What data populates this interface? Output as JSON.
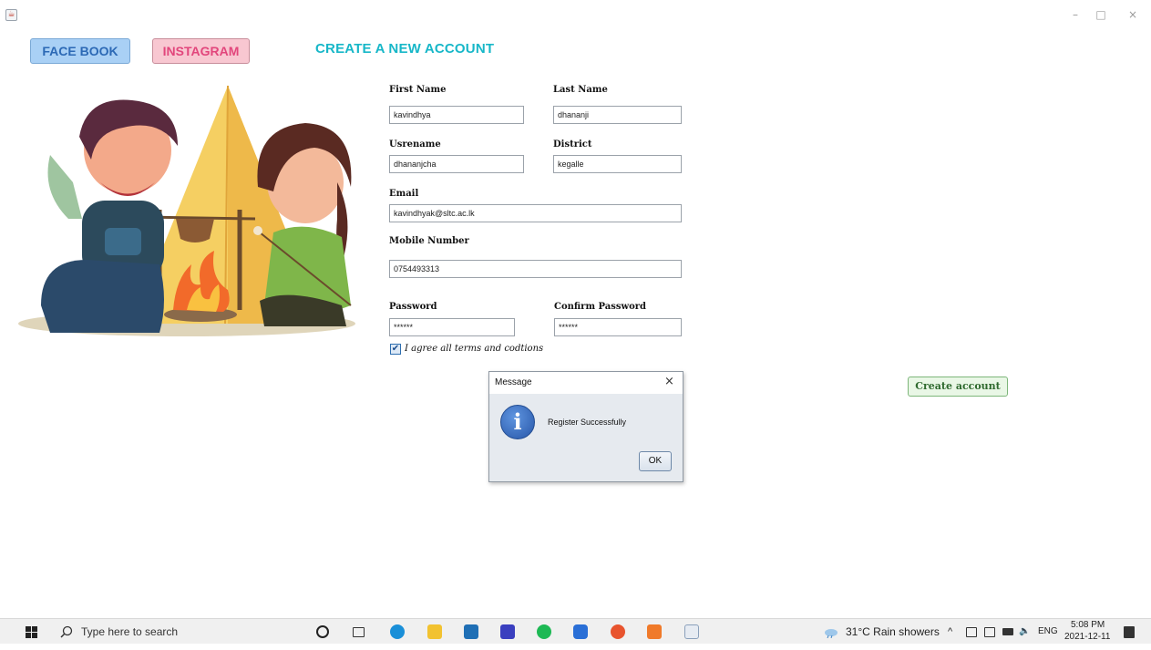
{
  "window": {
    "app_icon": "java-app-icon",
    "minimize": "–",
    "maximize": "□",
    "close": "×"
  },
  "nav": {
    "facebook_label": "FACE BOOK",
    "instagram_label": "INSTAGRAM"
  },
  "form": {
    "title": "CREATE A NEW ACCOUNT",
    "first_name": {
      "label": "First Name",
      "value": "kavindhya"
    },
    "last_name": {
      "label": "Last Name",
      "value": "dhananji"
    },
    "username": {
      "label": "Usrename",
      "value": "dhananjcha"
    },
    "district": {
      "label": "District",
      "value": "kegalle"
    },
    "email": {
      "label": "Email",
      "value": "kavindhyak@sltc.ac.lk"
    },
    "mobile": {
      "label": "Mobile Number",
      "value": "0754493313"
    },
    "password": {
      "label": "Password",
      "value": "******"
    },
    "confirm_password": {
      "label": "Confirm Password",
      "value": "******"
    },
    "terms": {
      "label": "I agree all terms and codtions",
      "checked": true,
      "check_glyph": "✔"
    },
    "create_label": "Create account"
  },
  "dialog": {
    "title": "Message",
    "close": "×",
    "icon_glyph": "i",
    "message": "Register Successfully",
    "ok_label": "OK"
  },
  "taskbar": {
    "search_placeholder": "Type here to search",
    "weather": "31°C  Rain showers",
    "language": "ENG",
    "time": "5:08 PM",
    "date": "2021-12-11"
  },
  "colors": {
    "accent_title": "#17b7c8",
    "facebook": "#a9d0f5",
    "instagram": "#f8c7d1"
  }
}
